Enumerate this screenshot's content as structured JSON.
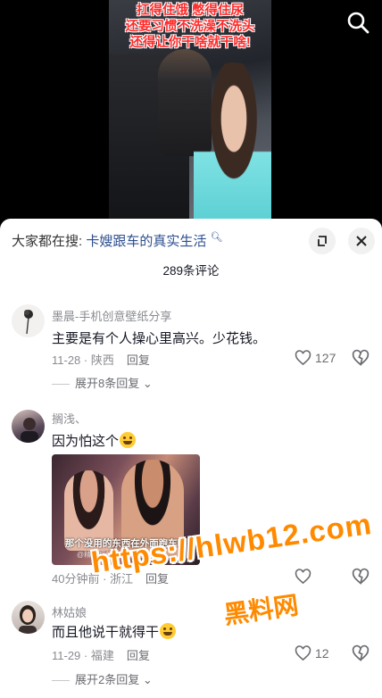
{
  "video": {
    "caption_lines": [
      "扛得住饿 憋得住尿",
      "还要习惯不洗澡不洗头",
      "还得让你干啥就干啥!"
    ]
  },
  "sheet": {
    "search_prefix": "大家都在搜:",
    "search_keyword": "卡嫂跟车的真实生活",
    "comment_count": "289条评论"
  },
  "comments": [
    {
      "user": "墨晨-手机创意壁纸分享",
      "text": "主要是有个人操心里高兴。少花钱。",
      "meta": "11-28 · 陕西",
      "reply_label": "回复",
      "likes": "127",
      "expand": "展开8条回复"
    },
    {
      "user": "搁浅、",
      "text": "因为怕这个",
      "image_subtitle": "那个没用的东西在外面跑车呢",
      "image_watermark": "@精彩视频...",
      "meta": "40分钟前 · 浙江",
      "reply_label": "回复",
      "likes": ""
    },
    {
      "user": "林姑娘",
      "text": "而且他说干就得干",
      "meta": "11-29 · 福建",
      "reply_label": "回复",
      "likes": "12",
      "expand": "展开2条回复"
    }
  ],
  "overlay": {
    "url": "https://hlwb12.com",
    "site_name": "黑料网"
  },
  "colors": {
    "caption_red": "#ff2a2a",
    "keyword_blue": "#2d4f8f",
    "watermark_orange": "#ff8a00"
  }
}
